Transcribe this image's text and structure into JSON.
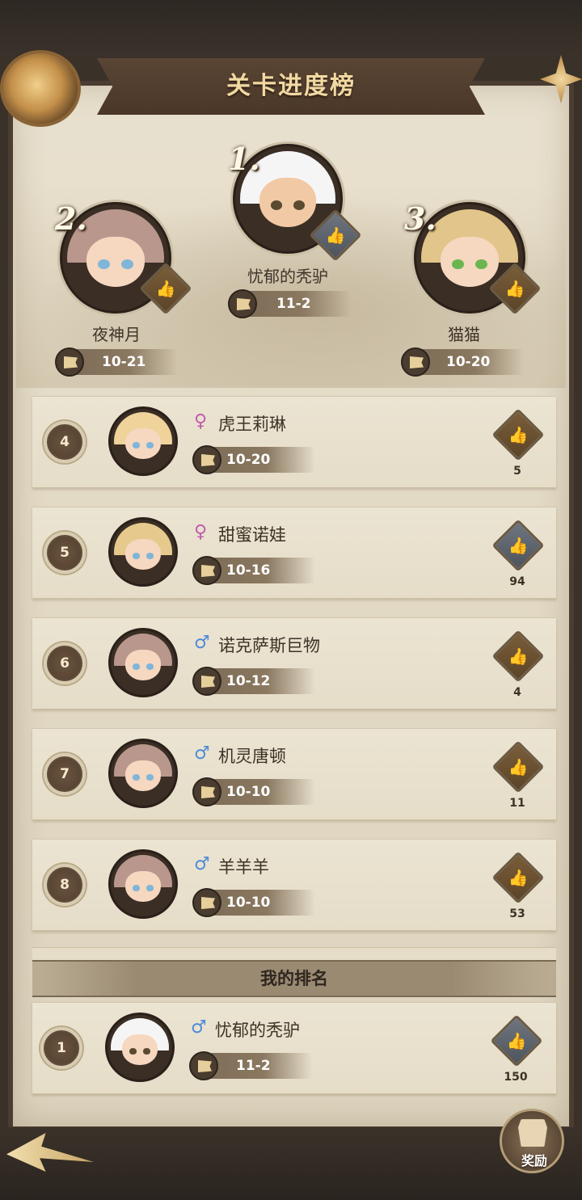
{
  "title": "关卡进度榜",
  "podium": [
    {
      "rank": "1.",
      "name": "忧郁的秃驴",
      "level": "11-2",
      "like_style": "grey",
      "hair": "#f5f5f5",
      "eyes": "#5a4a30",
      "face": "#f1c9a5"
    },
    {
      "rank": "2.",
      "name": "夜神月",
      "level": "10-21",
      "like_style": "gold",
      "hair": "#b9978c",
      "eyes": "#7fb6d8",
      "face": "#f6d7c0"
    },
    {
      "rank": "3.",
      "name": "猫猫",
      "level": "10-20",
      "like_style": "gold",
      "hair": "#e2c58a",
      "eyes": "#6ab54f",
      "face": "#f6d7c0"
    }
  ],
  "rows": [
    {
      "rank": "4",
      "gender": "♀",
      "gender_class": "female",
      "name": "虎王莉琳",
      "level": "10-20",
      "likes": "5",
      "like_style": "gold",
      "hair": "#efd39b",
      "eyes": "#7fb6d8"
    },
    {
      "rank": "5",
      "gender": "♀",
      "gender_class": "female",
      "name": "甜蜜诺娃",
      "level": "10-16",
      "likes": "94",
      "like_style": "grey",
      "hair": "#e6c98c",
      "eyes": "#7fb6d8"
    },
    {
      "rank": "6",
      "gender": "♂",
      "gender_class": "male",
      "name": "诺克萨斯巨物",
      "level": "10-12",
      "likes": "4",
      "like_style": "gold",
      "hair": "#b9978c",
      "eyes": "#7fb6d8"
    },
    {
      "rank": "7",
      "gender": "♂",
      "gender_class": "male",
      "name": "机灵唐顿",
      "level": "10-10",
      "likes": "11",
      "like_style": "gold",
      "hair": "#b9978c",
      "eyes": "#7fb6d8"
    },
    {
      "rank": "8",
      "gender": "♂",
      "gender_class": "male",
      "name": "羊羊羊",
      "level": "10-10",
      "likes": "53",
      "like_style": "gold",
      "hair": "#b9978c",
      "eyes": "#7fb6d8"
    }
  ],
  "my_rank": {
    "header": "我的排名",
    "rank": "1",
    "gender": "♂",
    "gender_class": "male",
    "name": "忧郁的秃驴",
    "level": "11-2",
    "likes": "150",
    "like_style": "grey",
    "hair": "#f5f5f5",
    "eyes": "#5a4a30"
  },
  "reward_label": "奖励",
  "like_icon": "👍",
  "icons": [
    "back-arrow-icon",
    "reward-icon",
    "flag-icon",
    "thumbs-up-icon",
    "medal-icon",
    "star-icon"
  ]
}
